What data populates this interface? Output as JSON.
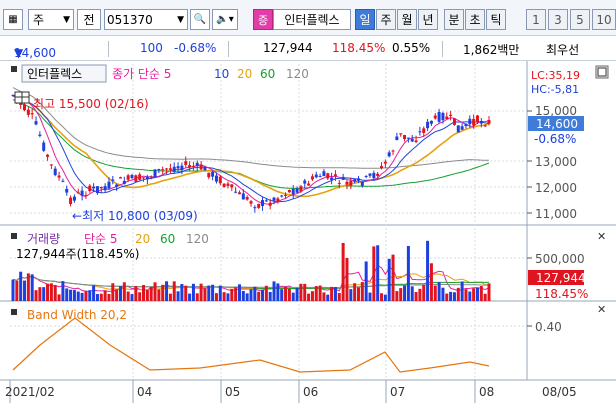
{
  "toolbar": {
    "market": "주",
    "type": "전",
    "code": "051370",
    "stock_name": "인터플렉스",
    "stock_tag": "증",
    "periods": [
      "일",
      "주",
      "월",
      "년",
      "분",
      "초",
      "틱"
    ],
    "active_period": "일",
    "minutes": [
      "1",
      "3",
      "5",
      "10"
    ]
  },
  "info": {
    "price": "14,600",
    "change": "100",
    "change_pct": "-0.68%",
    "volume": "127,944",
    "turnover_ratio": "118.45%",
    "foreign_ratio": "0.55%",
    "value": "1,862백만",
    "pref": "최우선"
  },
  "legend_price": {
    "name": "인터플렉스",
    "ma_label": "종가 단순 5",
    "ma_periods": [
      "5",
      "10",
      "20",
      "60",
      "120"
    ],
    "colors": [
      "#e61fa0",
      "#2244dd",
      "#e6a20f",
      "#13a02e",
      "#8b8b8b"
    ]
  },
  "legend_volume": {
    "name": "거래량",
    "ma_label": "단순 5",
    "ma_periods": [
      "20",
      "60",
      "120"
    ],
    "info": "127,944주(118.45%)"
  },
  "legend_bw": {
    "name": "Band Width 20,2"
  },
  "annotations": {
    "high": "최고 15,500 (02/16)",
    "low": "최저 10,800 (03/09)"
  },
  "right_axis": {
    "lc": "LC:35,19",
    "hc": "HC:-5,81",
    "ticks": [
      "15,000",
      "13,000",
      "12,000",
      "11,000"
    ],
    "current_price": "14,600",
    "current_pct": "-0.68%",
    "vol_tick": "500,000",
    "vol_current": "127,944",
    "vol_pct": "118.45%",
    "bw_tick": "0.40"
  },
  "x_axis": {
    "labels": [
      "2021/02",
      "04",
      "05",
      "06",
      "07",
      "08"
    ],
    "right_date": "08/05"
  },
  "colors": {
    "up": "#e0141e",
    "down": "#1d3fe0",
    "accent": "#3f7bd8"
  }
}
